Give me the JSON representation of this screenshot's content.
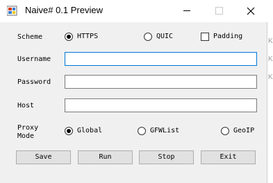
{
  "window": {
    "title": "Naive# 0.1 Preview",
    "icons": {
      "app": "app-icon",
      "minimize": "minimize-icon",
      "maximize": "maximize-icon",
      "close": "close-icon"
    }
  },
  "scheme": {
    "label": "Scheme",
    "options": [
      {
        "label": "HTTPS",
        "checked": true
      },
      {
        "label": "QUIC",
        "checked": false
      }
    ],
    "padding": {
      "label": "Padding",
      "checked": false
    }
  },
  "fields": {
    "username": {
      "label": "Username",
      "value": ""
    },
    "password": {
      "label": "Password",
      "value": ""
    },
    "host": {
      "label": "Host",
      "value": ""
    }
  },
  "proxy_mode": {
    "label_line1": "Proxy",
    "label_line2": "Mode",
    "options": [
      {
        "label": "Global",
        "checked": true
      },
      {
        "label": "GFWList",
        "checked": false
      },
      {
        "label": "GeoIP",
        "checked": false
      }
    ]
  },
  "buttons": {
    "save": "Save",
    "run": "Run",
    "stop": "Stop",
    "exit": "Exit"
  },
  "background_fragments": [
    "K",
    "K",
    "K"
  ]
}
